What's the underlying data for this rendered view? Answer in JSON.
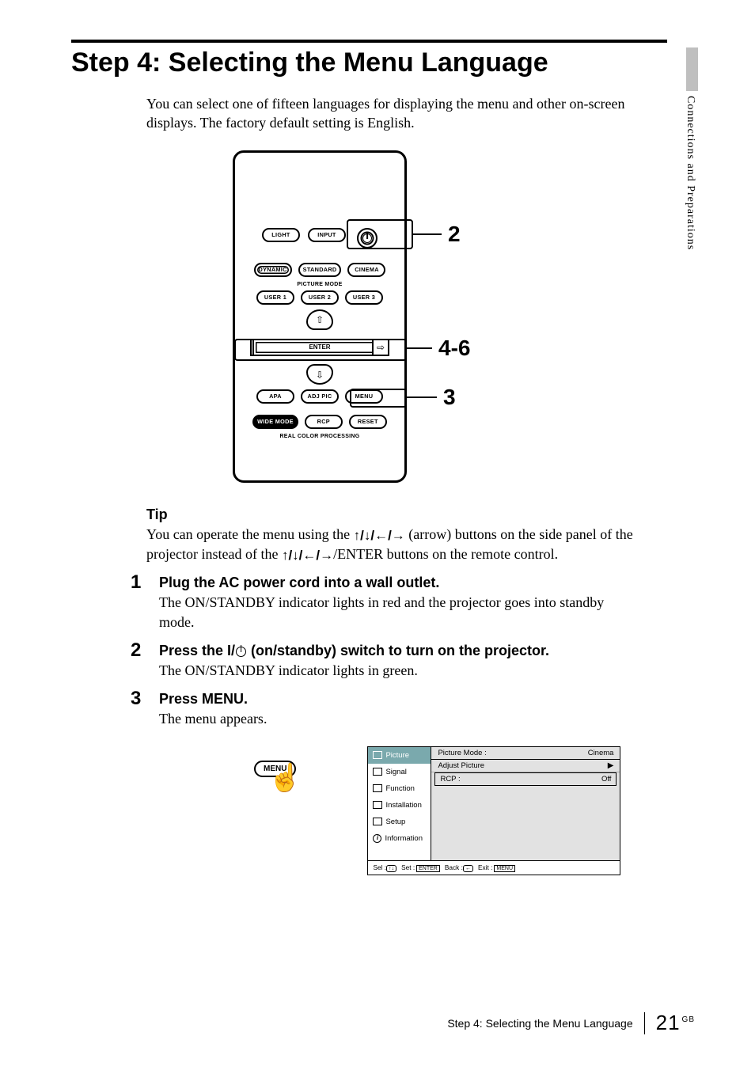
{
  "sidetab": {
    "label": "Connections and Preparations"
  },
  "title": "Step 4: Selecting the Menu Language",
  "intro": "You can select one of fifteen languages for displaying the menu and other on-screen displays. The factory default setting is English.",
  "remote": {
    "row1": {
      "light": "LIGHT",
      "input": "INPUT"
    },
    "mode_row1": {
      "dynamic": "DYNAMIC",
      "standard": "STANDARD",
      "cinema": "CINEMA"
    },
    "picture_mode_label": "PICTURE MODE",
    "mode_row2": {
      "user1": "USER 1",
      "user2": "USER 2",
      "user3": "USER 3"
    },
    "enter": "ENTER",
    "func_row1": {
      "apa": "APA",
      "adjpic": "ADJ PIC",
      "menu": "MENU"
    },
    "func_row2": {
      "widemode": "WIDE MODE",
      "rcp": "RCP",
      "reset": "RESET"
    },
    "rcp_label": "REAL COLOR PROCESSING"
  },
  "callouts": {
    "c2": "2",
    "c46": "4-6",
    "c3": "3"
  },
  "tip": {
    "heading": "Tip",
    "part1": "You can operate the menu using the ",
    "arrows": "↑/↓/←/→",
    "part2": " (arrow) buttons on the side panel of the projector instead of the ",
    "part3": "/ENTER buttons on the remote control."
  },
  "steps": {
    "s1": {
      "head": "Plug the AC power cord into a wall outlet.",
      "body": "The ON/STANDBY indicator lights in red and the projector goes into standby mode."
    },
    "s2": {
      "head_before": "Press the I/",
      "head_after": " (on/standby) switch to turn on the projector.",
      "body": "The ON/STANDBY indicator lights in green."
    },
    "s3": {
      "head": "Press MENU.",
      "body": "The menu appears."
    }
  },
  "menubtn": "MENU",
  "osd": {
    "sidebar": {
      "picture": "Picture",
      "signal": "Signal",
      "function": "Function",
      "installation": "Installation",
      "setup": "Setup",
      "information": "Information"
    },
    "main": {
      "picture_mode_label": "Picture Mode :",
      "picture_mode_value": "Cinema",
      "adjust_picture": "Adjust Picture",
      "rcp_label": "RCP :",
      "rcp_value": "Off"
    },
    "footer": {
      "sel": "Sel :",
      "set": "Set :",
      "enter": "ENTER",
      "back": "Back :",
      "exit": "Exit :",
      "menu": "MENU"
    }
  },
  "footer": {
    "title": "Step 4: Selecting the Menu Language",
    "page": "21",
    "gb": "GB"
  }
}
